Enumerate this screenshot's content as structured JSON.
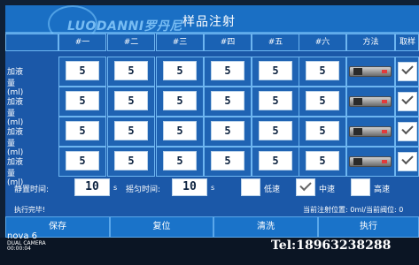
{
  "window": {
    "title": "样品注射",
    "logo": "LUODANNI罗丹尼"
  },
  "columns": [
    "#一",
    "#二",
    "#三",
    "#四",
    "#五",
    "#六"
  ],
  "method_header": "方法",
  "sample_header": "取样",
  "rows": [
    {
      "label": "加液量(ml)",
      "values": [
        "5",
        "5",
        "5",
        "5",
        "5",
        "5"
      ],
      "checked": true
    },
    {
      "label": "加液量(ml)",
      "values": [
        "5",
        "5",
        "5",
        "5",
        "5",
        "5"
      ],
      "checked": true
    },
    {
      "label": "加液量(ml)",
      "values": [
        "5",
        "5",
        "5",
        "5",
        "5",
        "5"
      ],
      "checked": true
    },
    {
      "label": "加液量(ml)",
      "values": [
        "5",
        "5",
        "5",
        "5",
        "5",
        "5"
      ],
      "checked": true
    }
  ],
  "settings": {
    "static_time_label": "静置时间:",
    "static_time_value": "10",
    "static_time_unit": "s",
    "shake_time_label": "摇匀时间:",
    "shake_time_value": "10",
    "shake_time_unit": "s",
    "speeds": [
      {
        "label": "低速",
        "checked": false
      },
      {
        "label": "中速",
        "checked": true
      },
      {
        "label": "高速",
        "checked": false
      }
    ]
  },
  "status": {
    "left": "执行完毕!",
    "right": "当前注射位置: 0ml/当前阀位: 0"
  },
  "buttons": [
    "保存",
    "复位",
    "清洗",
    "执行"
  ],
  "watermark": {
    "camera_brand": "nova 6",
    "camera_sub": "DUAL CAMERA",
    "camera_time": "00:00:04",
    "tel": "Tel:18963238288"
  },
  "colors": {
    "background": "#1b58a8",
    "cell_border": "#6db5f0",
    "button": "#1a73c9"
  }
}
